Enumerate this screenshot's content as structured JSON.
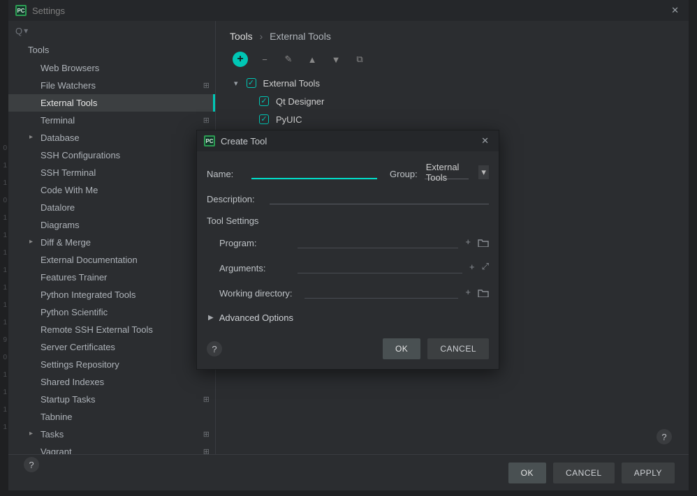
{
  "window": {
    "title": "Settings",
    "search_placeholder": ""
  },
  "sidebar": {
    "header": "Tools",
    "items": [
      {
        "label": "Web Browsers",
        "badge": ""
      },
      {
        "label": "File Watchers",
        "badge": "⊞"
      },
      {
        "label": "External Tools",
        "badge": "",
        "sel": true
      },
      {
        "label": "Terminal",
        "badge": "⊞"
      },
      {
        "label": "Database",
        "badge": "",
        "chev": true
      },
      {
        "label": "SSH Configurations",
        "badge": ""
      },
      {
        "label": "SSH Terminal",
        "badge": "⊞"
      },
      {
        "label": "Code With Me",
        "badge": ""
      },
      {
        "label": "Datalore",
        "badge": ""
      },
      {
        "label": "Diagrams",
        "badge": ""
      },
      {
        "label": "Diff & Merge",
        "badge": "",
        "chev": true
      },
      {
        "label": "External Documentation",
        "badge": ""
      },
      {
        "label": "Features Trainer",
        "badge": ""
      },
      {
        "label": "Python Integrated Tools",
        "badge": "⊞"
      },
      {
        "label": "Python Scientific",
        "badge": "⊞"
      },
      {
        "label": "Remote SSH External Tools",
        "badge": "⊞"
      },
      {
        "label": "Server Certificates",
        "badge": ""
      },
      {
        "label": "Settings Repository",
        "badge": ""
      },
      {
        "label": "Shared Indexes",
        "badge": ""
      },
      {
        "label": "Startup Tasks",
        "badge": "⊞"
      },
      {
        "label": "Tabnine",
        "badge": ""
      },
      {
        "label": "Tasks",
        "badge": "⊞",
        "chev": true
      },
      {
        "label": "Vagrant",
        "badge": "⊞"
      }
    ]
  },
  "breadcrumb": {
    "root": "Tools",
    "leaf": "External Tools",
    "sep": "›"
  },
  "tools": {
    "group": "External Tools",
    "items": [
      {
        "label": "Qt Designer"
      },
      {
        "label": "PyUIC"
      }
    ]
  },
  "footer": {
    "ok": "OK",
    "cancel": "CANCEL",
    "apply": "APPLY"
  },
  "dialog": {
    "title": "Create Tool",
    "name_label": "Name:",
    "name_value": "",
    "group_label": "Group:",
    "group_value": "External Tools",
    "desc_label": "Description:",
    "desc_value": "",
    "section": "Tool Settings",
    "program_label": "Program:",
    "program_value": "",
    "arguments_label": "Arguments:",
    "arguments_value": "",
    "workdir_label": "Working directory:",
    "workdir_value": "",
    "advanced": "Advanced Options",
    "ok": "OK",
    "cancel": "CANCEL"
  },
  "icons": {
    "search": "⌕",
    "close": "✕",
    "add": "+",
    "remove": "−",
    "edit": "✎",
    "up": "▲",
    "down": "▼",
    "copy": "⧉",
    "help": "?",
    "chev_down": "▾",
    "chev_right": "▸",
    "chev_open": "▾",
    "check": "✓",
    "plus_small": "+",
    "folder": "📁",
    "expand": "⤢",
    "tri_right": "▶"
  }
}
